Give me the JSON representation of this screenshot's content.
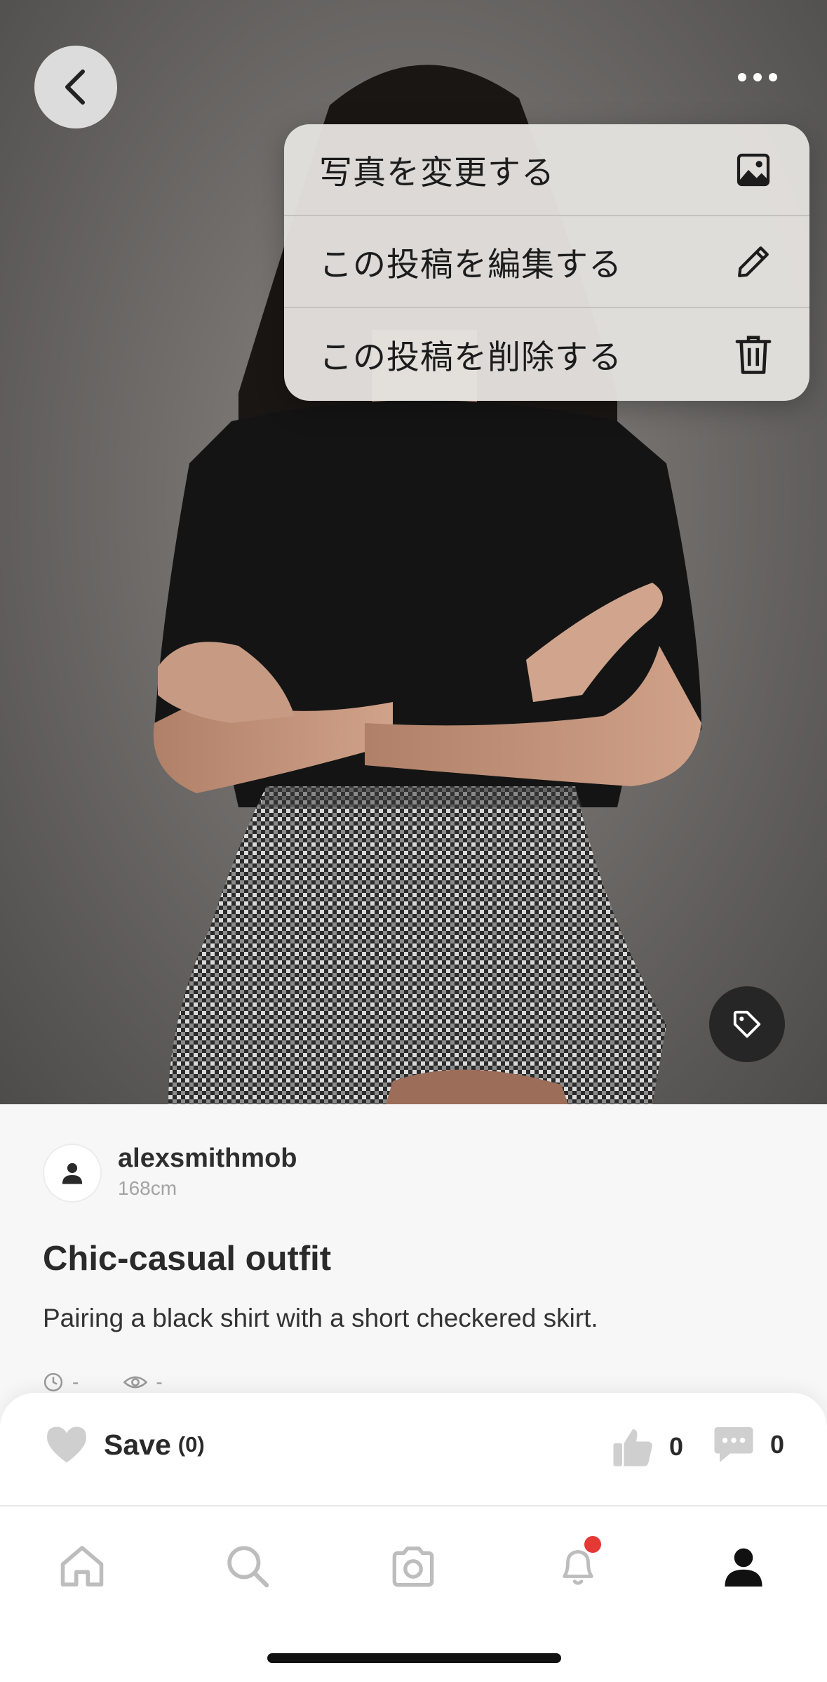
{
  "menu": {
    "items": [
      {
        "label": "写真を変更する",
        "icon": "image-icon"
      },
      {
        "label": "この投稿を編集する",
        "icon": "pencil-icon"
      },
      {
        "label": "この投稿を削除する",
        "icon": "trash-icon"
      }
    ]
  },
  "post": {
    "username": "alexsmithmob",
    "height": "168cm",
    "title": "Chic-casual outfit",
    "description": "Pairing a black shirt with a short checkered skirt.",
    "time": "-",
    "views": "-"
  },
  "actions": {
    "save_label": "Save",
    "save_count": "(0)",
    "likes": "0",
    "comments": "0"
  },
  "tabs": [
    "home",
    "search",
    "camera",
    "notifications",
    "profile"
  ],
  "colors": {
    "notification_dot": "#e53935",
    "menu_background": "#e4e2df",
    "tag_button": "#262626"
  }
}
